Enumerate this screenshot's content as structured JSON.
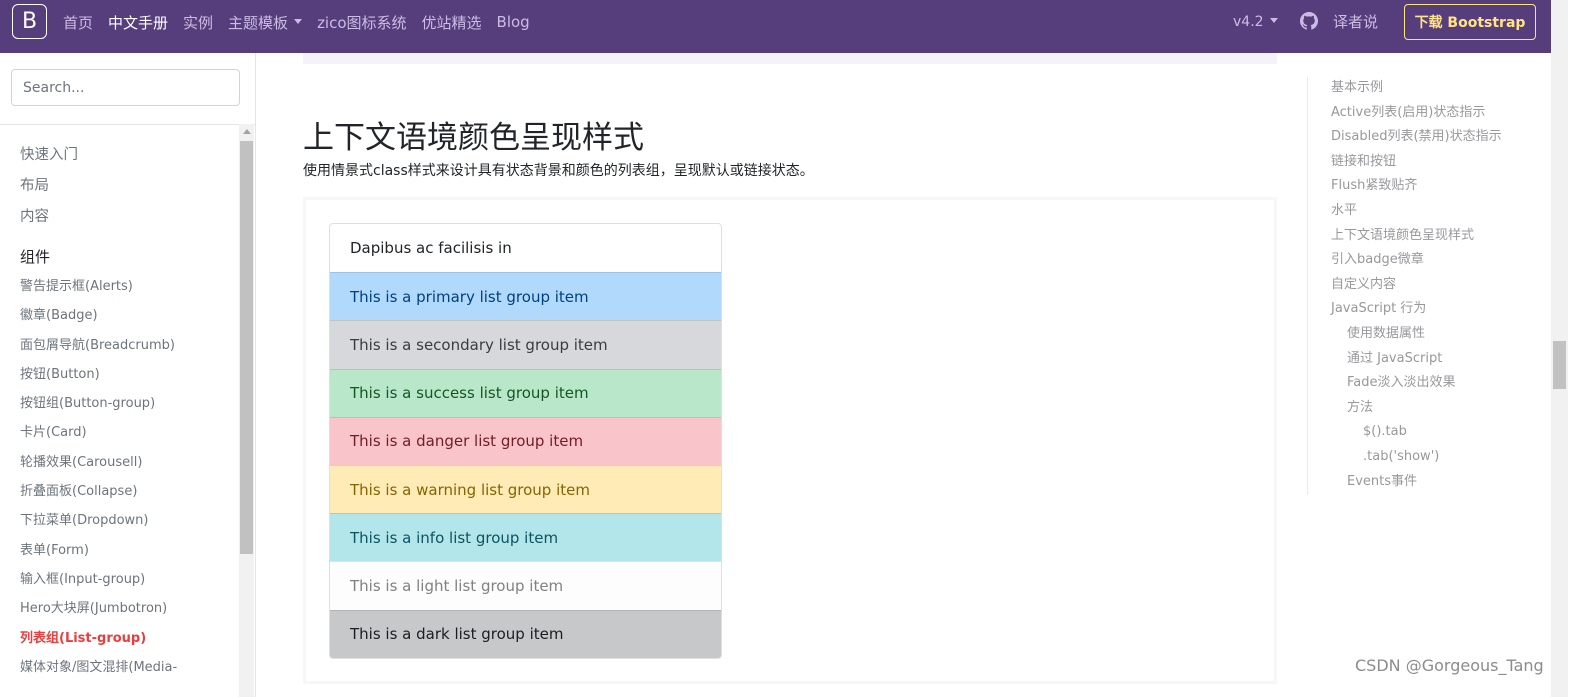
{
  "navbar": {
    "brand": "B",
    "links": [
      {
        "label": "首页",
        "active": false
      },
      {
        "label": "中文手册",
        "active": true
      },
      {
        "label": "实例",
        "active": false
      },
      {
        "label": "主题模板",
        "active": false,
        "dropdown": true
      },
      {
        "label": "zico图标系统",
        "active": false
      },
      {
        "label": "优站精选",
        "active": false
      },
      {
        "label": "Blog",
        "active": false
      }
    ],
    "version": "v4.2",
    "github_icon": "github-icon",
    "translator": "译者说",
    "download": "下载 Bootstrap"
  },
  "sidebar": {
    "search_placeholder": "Search...",
    "top_items": [
      "快速入门",
      "布局",
      "内容"
    ],
    "section_title": "组件",
    "items": [
      {
        "label": "警告提示框(Alerts)",
        "active": false
      },
      {
        "label": "徽章(Badge)",
        "active": false
      },
      {
        "label": "面包屑导航(Breadcrumb)",
        "active": false
      },
      {
        "label": "按钮(Button)",
        "active": false
      },
      {
        "label": "按钮组(Button-group)",
        "active": false
      },
      {
        "label": "卡片(Card)",
        "active": false
      },
      {
        "label": "轮播效果(Carousell)",
        "active": false
      },
      {
        "label": "折叠面板(Collapse)",
        "active": false
      },
      {
        "label": "下拉菜单(Dropdown)",
        "active": false
      },
      {
        "label": "表单(Form)",
        "active": false
      },
      {
        "label": "输入框(Input-group)",
        "active": false
      },
      {
        "label": "Hero大块屏(Jumbotron)",
        "active": false
      },
      {
        "label": "列表组(List-group)",
        "active": true
      },
      {
        "label": "媒体对象/图文混排(Media-",
        "active": false
      }
    ]
  },
  "main": {
    "title": "上下文语境颜色呈现样式",
    "description": "使用情景式class样式来设计具有状态背景和颜色的列表组，呈现默认或链接状态。",
    "list_items": [
      {
        "label": "Dapibus ac facilisis in",
        "bg": "#ffffff",
        "color": "#212529"
      },
      {
        "label": "This is a primary list group item",
        "bg": "#b0d9fc",
        "color": "#004085"
      },
      {
        "label": "This is a secondary list group item",
        "bg": "#d6d8db",
        "color": "#383d41"
      },
      {
        "label": "This is a success list group item",
        "bg": "#b8e7c9",
        "color": "#155724"
      },
      {
        "label": "This is a danger list group item",
        "bg": "#fac5ca",
        "color": "#721c24"
      },
      {
        "label": "This is a warning list group item",
        "bg": "#feebb5",
        "color": "#856404"
      },
      {
        "label": "This is a info list group item",
        "bg": "#b3e6ea",
        "color": "#0c5460"
      },
      {
        "label": "This is a light list group item",
        "bg": "#fdfdfe",
        "color": "#818182"
      },
      {
        "label": "This is a dark list group item",
        "bg": "#c6c8ca",
        "color": "#1b1e21"
      }
    ]
  },
  "toc": [
    {
      "label": "基本示例",
      "level": 1
    },
    {
      "label": "Active列表(启用)状态指示",
      "level": 1
    },
    {
      "label": "Disabled列表(禁用)状态指示",
      "level": 1
    },
    {
      "label": "链接和按钮",
      "level": 1
    },
    {
      "label": "Flush紧致贴齐",
      "level": 1
    },
    {
      "label": "水平",
      "level": 1
    },
    {
      "label": "上下文语境颜色呈现样式",
      "level": 1
    },
    {
      "label": "引入badge微章",
      "level": 1
    },
    {
      "label": "自定义内容",
      "level": 1
    },
    {
      "label": "JavaScript 行为",
      "level": 1
    },
    {
      "label": "使用数据属性",
      "level": 2
    },
    {
      "label": "通过 JavaScript",
      "level": 2
    },
    {
      "label": "Fade淡入淡出效果",
      "level": 2
    },
    {
      "label": "方法",
      "level": 2
    },
    {
      "label": "$().tab",
      "level": 3
    },
    {
      "label": ".tab('show')",
      "level": 3
    },
    {
      "label": "Events事件",
      "level": 2
    }
  ],
  "watermark": "CSDN @Gorgeous_Tang",
  "colors": {
    "navbar": "#563d7c",
    "download_accent": "#ffe484",
    "sidebar_active": "#e83e3e"
  }
}
